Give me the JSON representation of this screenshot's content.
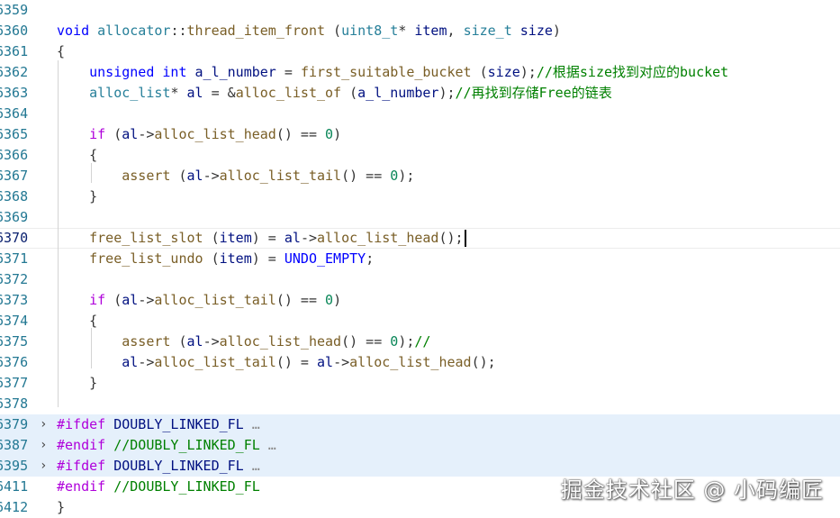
{
  "editor": {
    "current_line": "6370",
    "lines": [
      {
        "num": "6359",
        "fold": "",
        "folded": false,
        "tokens": []
      },
      {
        "num": "6360",
        "fold": "",
        "folded": false,
        "tokens": [
          {
            "t": "void ",
            "c": "kw"
          },
          {
            "t": "allocator",
            "c": "type"
          },
          {
            "t": "::",
            "c": "plain"
          },
          {
            "t": "thread_item_front",
            "c": "fn"
          },
          {
            "t": " (",
            "c": "plain"
          },
          {
            "t": "uint8_t",
            "c": "type"
          },
          {
            "t": "* ",
            "c": "plain"
          },
          {
            "t": "item",
            "c": "var"
          },
          {
            "t": ", ",
            "c": "plain"
          },
          {
            "t": "size_t",
            "c": "type"
          },
          {
            "t": " ",
            "c": "plain"
          },
          {
            "t": "size",
            "c": "var"
          },
          {
            "t": ")",
            "c": "plain"
          }
        ]
      },
      {
        "num": "6361",
        "fold": "",
        "folded": false,
        "tokens": [
          {
            "t": "{",
            "c": "plain"
          }
        ]
      },
      {
        "num": "6362",
        "fold": "",
        "folded": false,
        "tokens": [
          {
            "t": "    ",
            "c": "plain"
          },
          {
            "t": "unsigned int",
            "c": "kw"
          },
          {
            "t": " ",
            "c": "plain"
          },
          {
            "t": "a_l_number",
            "c": "var"
          },
          {
            "t": " = ",
            "c": "plain"
          },
          {
            "t": "first_suitable_bucket",
            "c": "fn"
          },
          {
            "t": " (",
            "c": "plain"
          },
          {
            "t": "size",
            "c": "var"
          },
          {
            "t": ");",
            "c": "plain"
          },
          {
            "t": "//根据size找到对应的bucket",
            "c": "com"
          }
        ]
      },
      {
        "num": "6363",
        "fold": "",
        "folded": false,
        "tokens": [
          {
            "t": "    ",
            "c": "plain"
          },
          {
            "t": "alloc_list",
            "c": "type"
          },
          {
            "t": "* ",
            "c": "plain"
          },
          {
            "t": "al",
            "c": "var"
          },
          {
            "t": " = &",
            "c": "plain"
          },
          {
            "t": "alloc_list_of",
            "c": "fn"
          },
          {
            "t": " (",
            "c": "plain"
          },
          {
            "t": "a_l_number",
            "c": "var"
          },
          {
            "t": ");",
            "c": "plain"
          },
          {
            "t": "//再找到存储Free的链表",
            "c": "com"
          }
        ]
      },
      {
        "num": "6364",
        "fold": "",
        "folded": false,
        "tokens": []
      },
      {
        "num": "6365",
        "fold": "",
        "folded": false,
        "tokens": [
          {
            "t": "    ",
            "c": "plain"
          },
          {
            "t": "if",
            "c": "ctrl"
          },
          {
            "t": " (",
            "c": "plain"
          },
          {
            "t": "al",
            "c": "var"
          },
          {
            "t": "->",
            "c": "plain"
          },
          {
            "t": "alloc_list_head",
            "c": "fn"
          },
          {
            "t": "() == ",
            "c": "plain"
          },
          {
            "t": "0",
            "c": "num"
          },
          {
            "t": ")",
            "c": "plain"
          }
        ]
      },
      {
        "num": "6366",
        "fold": "",
        "folded": false,
        "tokens": [
          {
            "t": "    {",
            "c": "plain"
          }
        ]
      },
      {
        "num": "6367",
        "fold": "",
        "folded": false,
        "tokens": [
          {
            "t": "        ",
            "c": "plain"
          },
          {
            "t": "assert",
            "c": "fn"
          },
          {
            "t": " (",
            "c": "plain"
          },
          {
            "t": "al",
            "c": "var"
          },
          {
            "t": "->",
            "c": "plain"
          },
          {
            "t": "alloc_list_tail",
            "c": "fn"
          },
          {
            "t": "() == ",
            "c": "plain"
          },
          {
            "t": "0",
            "c": "num"
          },
          {
            "t": ");",
            "c": "plain"
          }
        ]
      },
      {
        "num": "6368",
        "fold": "",
        "folded": false,
        "tokens": [
          {
            "t": "    }",
            "c": "plain"
          }
        ]
      },
      {
        "num": "6369",
        "fold": "",
        "folded": false,
        "tokens": []
      },
      {
        "num": "6370",
        "fold": "",
        "folded": false,
        "caret": true,
        "tokens": [
          {
            "t": "    ",
            "c": "plain"
          },
          {
            "t": "free_list_slot",
            "c": "fn"
          },
          {
            "t": " (",
            "c": "plain"
          },
          {
            "t": "item",
            "c": "var"
          },
          {
            "t": ") = ",
            "c": "plain"
          },
          {
            "t": "al",
            "c": "var"
          },
          {
            "t": "->",
            "c": "plain"
          },
          {
            "t": "alloc_list_head",
            "c": "fn"
          },
          {
            "t": "();",
            "c": "plain"
          }
        ]
      },
      {
        "num": "6371",
        "fold": "",
        "folded": false,
        "tokens": [
          {
            "t": "    ",
            "c": "plain"
          },
          {
            "t": "free_list_undo",
            "c": "fn"
          },
          {
            "t": " (",
            "c": "plain"
          },
          {
            "t": "item",
            "c": "var"
          },
          {
            "t": ") = ",
            "c": "plain"
          },
          {
            "t": "UNDO_EMPTY",
            "c": "mac"
          },
          {
            "t": ";",
            "c": "plain"
          }
        ]
      },
      {
        "num": "6372",
        "fold": "",
        "folded": false,
        "tokens": []
      },
      {
        "num": "6373",
        "fold": "",
        "folded": false,
        "tokens": [
          {
            "t": "    ",
            "c": "plain"
          },
          {
            "t": "if",
            "c": "ctrl"
          },
          {
            "t": " (",
            "c": "plain"
          },
          {
            "t": "al",
            "c": "var"
          },
          {
            "t": "->",
            "c": "plain"
          },
          {
            "t": "alloc_list_tail",
            "c": "fn"
          },
          {
            "t": "() == ",
            "c": "plain"
          },
          {
            "t": "0",
            "c": "num"
          },
          {
            "t": ")",
            "c": "plain"
          }
        ]
      },
      {
        "num": "6374",
        "fold": "",
        "folded": false,
        "tokens": [
          {
            "t": "    {",
            "c": "plain"
          }
        ]
      },
      {
        "num": "6375",
        "fold": "",
        "folded": false,
        "tokens": [
          {
            "t": "        ",
            "c": "plain"
          },
          {
            "t": "assert",
            "c": "fn"
          },
          {
            "t": " (",
            "c": "plain"
          },
          {
            "t": "al",
            "c": "var"
          },
          {
            "t": "->",
            "c": "plain"
          },
          {
            "t": "alloc_list_head",
            "c": "fn"
          },
          {
            "t": "() == ",
            "c": "plain"
          },
          {
            "t": "0",
            "c": "num"
          },
          {
            "t": ");",
            "c": "plain"
          },
          {
            "t": "//",
            "c": "com"
          }
        ]
      },
      {
        "num": "6376",
        "fold": "",
        "folded": false,
        "tokens": [
          {
            "t": "        ",
            "c": "plain"
          },
          {
            "t": "al",
            "c": "var"
          },
          {
            "t": "->",
            "c": "plain"
          },
          {
            "t": "alloc_list_tail",
            "c": "fn"
          },
          {
            "t": "() = ",
            "c": "plain"
          },
          {
            "t": "al",
            "c": "var"
          },
          {
            "t": "->",
            "c": "plain"
          },
          {
            "t": "alloc_list_head",
            "c": "fn"
          },
          {
            "t": "();",
            "c": "plain"
          }
        ]
      },
      {
        "num": "6377",
        "fold": "",
        "folded": false,
        "tokens": [
          {
            "t": "    }",
            "c": "plain"
          }
        ]
      },
      {
        "num": "6378",
        "fold": "",
        "folded": false,
        "tokens": []
      },
      {
        "num": "6379",
        "fold": "›",
        "folded": true,
        "tokens": [
          {
            "t": "#ifdef",
            "c": "ctrl"
          },
          {
            "t": " ",
            "c": "plain"
          },
          {
            "t": "DOUBLY_LINKED_FL",
            "c": "var"
          },
          {
            "t": " …",
            "c": "ell"
          }
        ]
      },
      {
        "num": "6387",
        "fold": "›",
        "folded": true,
        "tokens": [
          {
            "t": "#endif",
            "c": "ctrl"
          },
          {
            "t": " ",
            "c": "plain"
          },
          {
            "t": "//DOUBLY_LINKED_FL",
            "c": "com"
          },
          {
            "t": " …",
            "c": "ell"
          }
        ]
      },
      {
        "num": "6395",
        "fold": "›",
        "folded": true,
        "tokens": [
          {
            "t": "#ifdef",
            "c": "ctrl"
          },
          {
            "t": " ",
            "c": "plain"
          },
          {
            "t": "DOUBLY_LINKED_FL",
            "c": "var"
          },
          {
            "t": " …",
            "c": "ell"
          }
        ]
      },
      {
        "num": "6411",
        "fold": "",
        "folded": false,
        "tokens": [
          {
            "t": "#endif",
            "c": "ctrl"
          },
          {
            "t": " ",
            "c": "plain"
          },
          {
            "t": "//DOUBLY_LINKED_FL",
            "c": "com"
          }
        ]
      },
      {
        "num": "6412",
        "fold": "",
        "folded": false,
        "tokens": [
          {
            "t": "}",
            "c": "plain"
          }
        ]
      }
    ]
  },
  "watermark": "掘金技术社区 @ 小码编匠"
}
